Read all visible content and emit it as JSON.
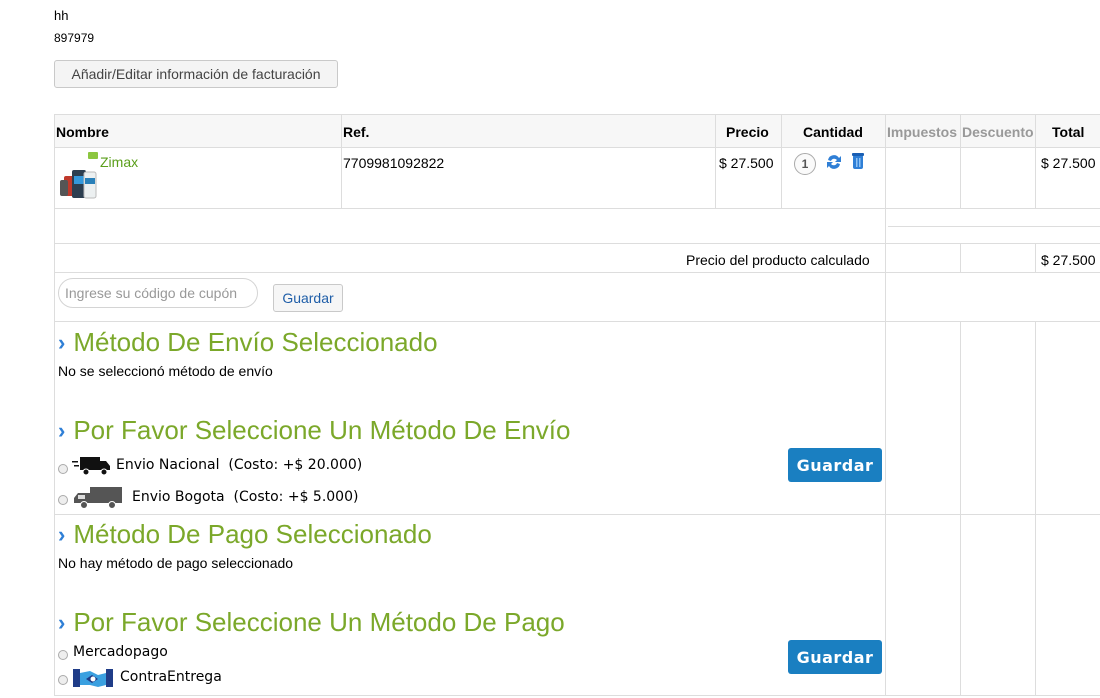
{
  "customer": {
    "name": "hh",
    "phone": "897979"
  },
  "billing_button": "Añadir/Editar información de facturación",
  "table": {
    "headers": {
      "name": "Nombre",
      "ref": "Ref.",
      "price": "Precio",
      "qty": "Cantidad",
      "taxes": "Impuestos",
      "discount": "Descuento",
      "total": "Total"
    },
    "product": {
      "name": "Zimax",
      "ref": "7709981092822",
      "price": "$ 27.500",
      "qty": "1",
      "total": "$ 27.500"
    },
    "subtotal_label": "Precio del producto calculado",
    "subtotal_value": "$ 27.500"
  },
  "coupon": {
    "placeholder": "Ingrese su código de cupón",
    "save_label": "Guardar"
  },
  "shipping_selected": {
    "title": "Método De Envío Seleccionado",
    "text": "No se seleccionó método de envío"
  },
  "shipping_select": {
    "title": "Por Favor Seleccione Un Método De Envío",
    "options": [
      {
        "name": "Envio Nacional",
        "cost": "(Costo: +$ 20.000)"
      },
      {
        "name": "Envio Bogota",
        "cost": "(Costo: +$ 5.000)"
      }
    ],
    "save_label": "Guardar"
  },
  "payment_selected": {
    "title": "Método De Pago Seleccionado",
    "text": "No hay método de pago seleccionado"
  },
  "payment_select": {
    "title": "Por Favor Seleccione Un Método De Pago",
    "options": [
      {
        "name": "Mercadopago"
      },
      {
        "name": "ContraEntrega"
      }
    ],
    "save_label": "Guardar"
  },
  "colors": {
    "section_title": "#7ba82a",
    "chevron": "#2f7fd6",
    "primary_button": "#1a7fc1"
  }
}
